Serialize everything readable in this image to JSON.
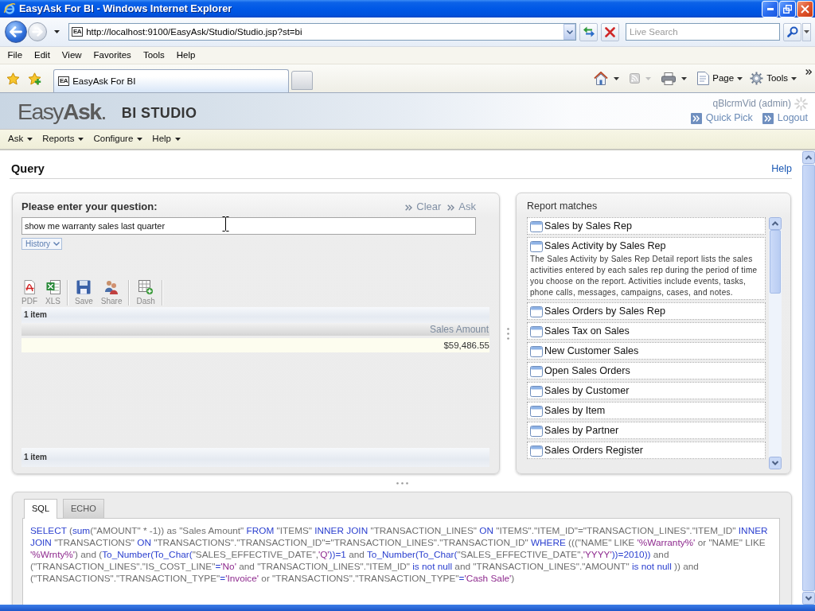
{
  "window": {
    "title": "EasyAsk For BI - Windows Internet Explorer"
  },
  "address_bar": {
    "favicon": "EA",
    "url": "http://localhost:9100/EasyAsk/Studio/Studio.jsp?st=bi"
  },
  "search": {
    "placeholder": "Live Search"
  },
  "menu_bar": [
    "File",
    "Edit",
    "View",
    "Favorites",
    "Tools",
    "Help"
  ],
  "tabs": [
    {
      "favicon": "EA",
      "label": "EasyAsk For BI",
      "selected": true
    }
  ],
  "command_buttons": [
    {
      "kind": "page",
      "label": "Page"
    },
    {
      "kind": "tools",
      "label": "Tools"
    }
  ],
  "app": {
    "logo": "Easy**Ask**.",
    "product": "BI STUDIO",
    "user": "qBlcrmVid (admin)",
    "links": [
      "Quick Pick",
      "Logout"
    ],
    "menu": [
      "Ask",
      "Reports",
      "Configure",
      "Help"
    ]
  },
  "query_page": {
    "title": "Query",
    "help": "Help"
  },
  "question_panel": {
    "label": "Please enter your question:",
    "actions": [
      "Clear",
      "Ask"
    ],
    "question": "show me warranty sales last quarter",
    "history": "History",
    "toolbar": [
      [
        {
          "kind": "pdf",
          "label": "PDF"
        },
        {
          "kind": "xls",
          "label": "XLS"
        }
      ],
      [
        {
          "kind": "save",
          "label": "Save"
        },
        {
          "kind": "share",
          "label": "Share"
        }
      ],
      [
        {
          "kind": "dash",
          "label": "Dash"
        }
      ]
    ]
  },
  "result": {
    "count": "1 item",
    "columns": [
      "Sales Amount"
    ],
    "rows": [
      [
        "$59,486.55"
      ]
    ],
    "footer_count": "1 item"
  },
  "report_matches": {
    "title": "Report matches",
    "items": [
      {
        "title": "Sales by Sales Rep"
      },
      {
        "title": "Sales Activity by Sales Rep",
        "description": "The Sales Activity by Sales Rep Detail report lists the sales activities entered by each sales rep during the period of time you choose on the report. Activities include events, tasks, phone calls, messages, campaigns, cases, and notes."
      },
      {
        "title": "Sales Orders by Sales Rep"
      },
      {
        "title": "Sales Tax on Sales"
      },
      {
        "title": "New Customer Sales"
      },
      {
        "title": "Open Sales Orders"
      },
      {
        "title": "Sales by Customer"
      },
      {
        "title": "Sales by Item"
      },
      {
        "title": "Sales by Partner"
      },
      {
        "title": "Sales Orders Register"
      }
    ]
  },
  "sql_panel": {
    "tabs": [
      {
        "label": "SQL",
        "selected": true
      },
      {
        "label": "ECHO",
        "selected": false
      }
    ],
    "sql": [
      {
        "kind": "keyword",
        "text": "SELECT "
      },
      {
        "kind": "identifier",
        "text": "("
      },
      {
        "kind": "keyword",
        "text": "sum"
      },
      {
        "kind": "identifier",
        "text": "(\"AMOUNT\" * -1)) as \"Sales Amount\" "
      },
      {
        "kind": "keyword",
        "text": "FROM "
      },
      {
        "kind": "identifier",
        "text": "\"ITEMS\" "
      },
      {
        "kind": "keyword",
        "text": "INNER JOIN "
      },
      {
        "kind": "identifier",
        "text": "\"TRANSACTION_LINES\" "
      },
      {
        "kind": "keyword",
        "text": "ON "
      },
      {
        "kind": "identifier",
        "text": "\"ITEMS\".\"ITEM_ID\"=\"TRANSACTION_LINES\".\"ITEM_ID\" "
      },
      {
        "kind": "keyword",
        "text": "INNER JOIN "
      },
      {
        "kind": "identifier",
        "text": "\"TRANSACTIONS\" "
      },
      {
        "kind": "keyword",
        "text": "ON "
      },
      {
        "kind": "identifier",
        "text": "\"TRANSACTIONS\".\"TRANSACTION_ID\"=\"TRANSACTION_LINES\".\"TRANSACTION_ID\" "
      },
      {
        "kind": "keyword",
        "text": "WHERE "
      },
      {
        "kind": "identifier",
        "text": "(((\"NAME\" LIKE "
      },
      {
        "kind": "string",
        "text": "'%Warranty%'"
      },
      {
        "kind": "identifier",
        "text": " or \"NAME\" LIKE "
      },
      {
        "kind": "string",
        "text": "'%Wrnty%'"
      },
      {
        "kind": "identifier",
        "text": ") and ("
      },
      {
        "kind": "keyword",
        "text": "To_Number(To_Char("
      },
      {
        "kind": "identifier",
        "text": "\"SALES_EFFECTIVE_DATE\","
      },
      {
        "kind": "string",
        "text": "'Q'"
      },
      {
        "kind": "keyword",
        "text": "))=1"
      },
      {
        "kind": "identifier",
        "text": " and "
      },
      {
        "kind": "keyword",
        "text": "To_Number(To_Char("
      },
      {
        "kind": "identifier",
        "text": "\"SALES_EFFECTIVE_DATE\","
      },
      {
        "kind": "string",
        "text": "'YYYY'"
      },
      {
        "kind": "keyword",
        "text": "))=2010))"
      },
      {
        "kind": "identifier",
        "text": " and (\"TRANSACTION_LINES\".\"IS_COST_LINE\""
      },
      {
        "kind": "keyword",
        "text": "="
      },
      {
        "kind": "string",
        "text": "'No'"
      },
      {
        "kind": "identifier",
        "text": " and \"TRANSACTION_LINES\".\"ITEM_ID\" "
      },
      {
        "kind": "keyword",
        "text": "is not null"
      },
      {
        "kind": "identifier",
        "text": " and \"TRANSACTION_LINES\".\"AMOUNT\" "
      },
      {
        "kind": "keyword",
        "text": "is not null"
      },
      {
        "kind": "identifier",
        "text": " )) and (\"TRANSACTIONS\".\"TRANSACTION_TYPE\""
      },
      {
        "kind": "keyword",
        "text": "="
      },
      {
        "kind": "string",
        "text": "'Invoice'"
      },
      {
        "kind": "identifier",
        "text": " or \"TRANSACTIONS\".\"TRANSACTION_TYPE\""
      },
      {
        "kind": "keyword",
        "text": "="
      },
      {
        "kind": "string",
        "text": "'Cash Sale'"
      },
      {
        "kind": "identifier",
        "text": ")"
      }
    ]
  }
}
